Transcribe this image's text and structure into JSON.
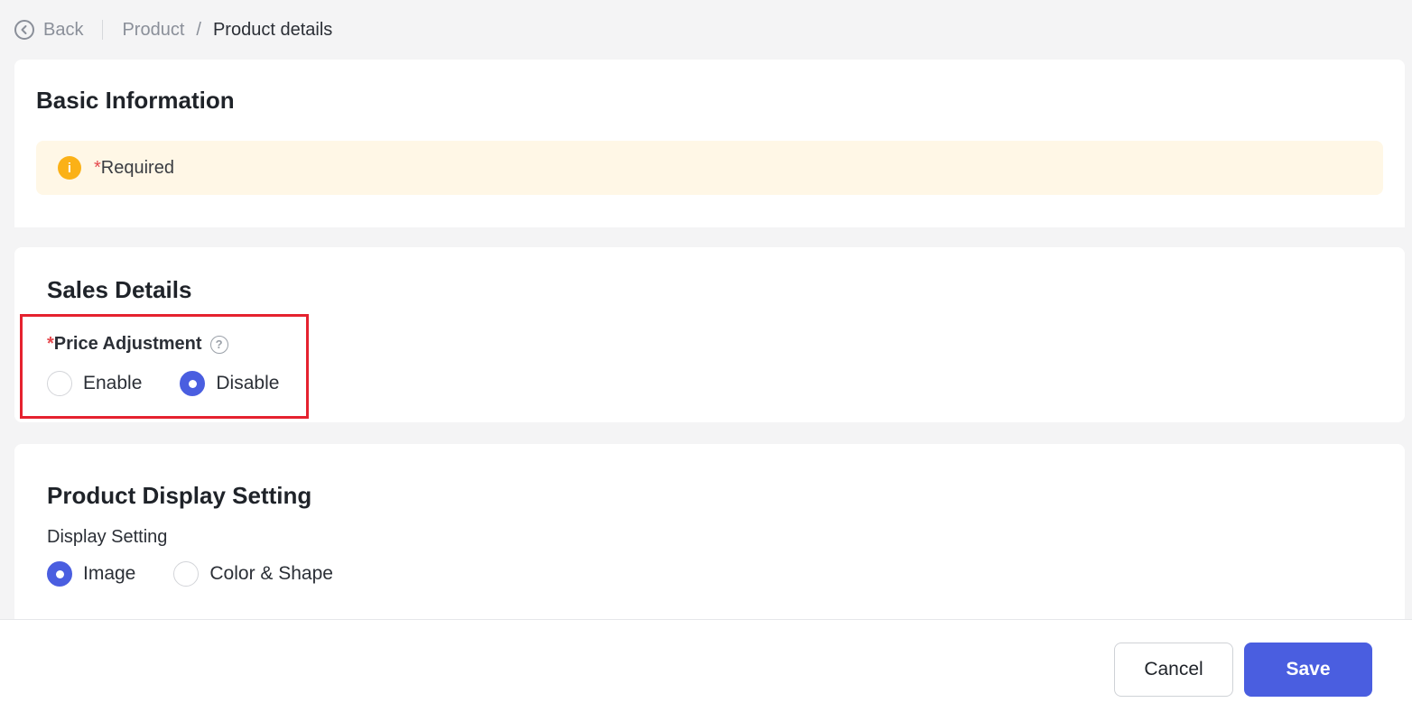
{
  "breadcrumb": {
    "back_label": "Back",
    "parent": "Product",
    "separator": "/",
    "current": "Product details"
  },
  "basic_info": {
    "title": "Basic Information",
    "notice_star": "*",
    "notice_text": "Required"
  },
  "sales_details": {
    "title": "Sales Details",
    "price_adjustment": {
      "star": "*",
      "label": "Price Adjustment",
      "help_glyph": "?",
      "options": [
        {
          "label": "Enable",
          "checked": false
        },
        {
          "label": "Disable",
          "checked": true
        }
      ]
    }
  },
  "display_setting": {
    "title": "Product Display Setting",
    "field_label": "Display Setting",
    "options": [
      {
        "label": "Image",
        "checked": true
      },
      {
        "label": "Color & Shape",
        "checked": false
      }
    ]
  },
  "footer": {
    "cancel_label": "Cancel",
    "save_label": "Save"
  },
  "colors": {
    "primary": "#4a5ee0",
    "warning_bg": "#fff7e6",
    "info_icon": "#fbb117",
    "required": "#e5484d",
    "highlight_border": "#e5222f"
  },
  "icons": {
    "back": "back-arrow-circle-icon",
    "info": "info-icon",
    "help": "question-circle-icon"
  }
}
